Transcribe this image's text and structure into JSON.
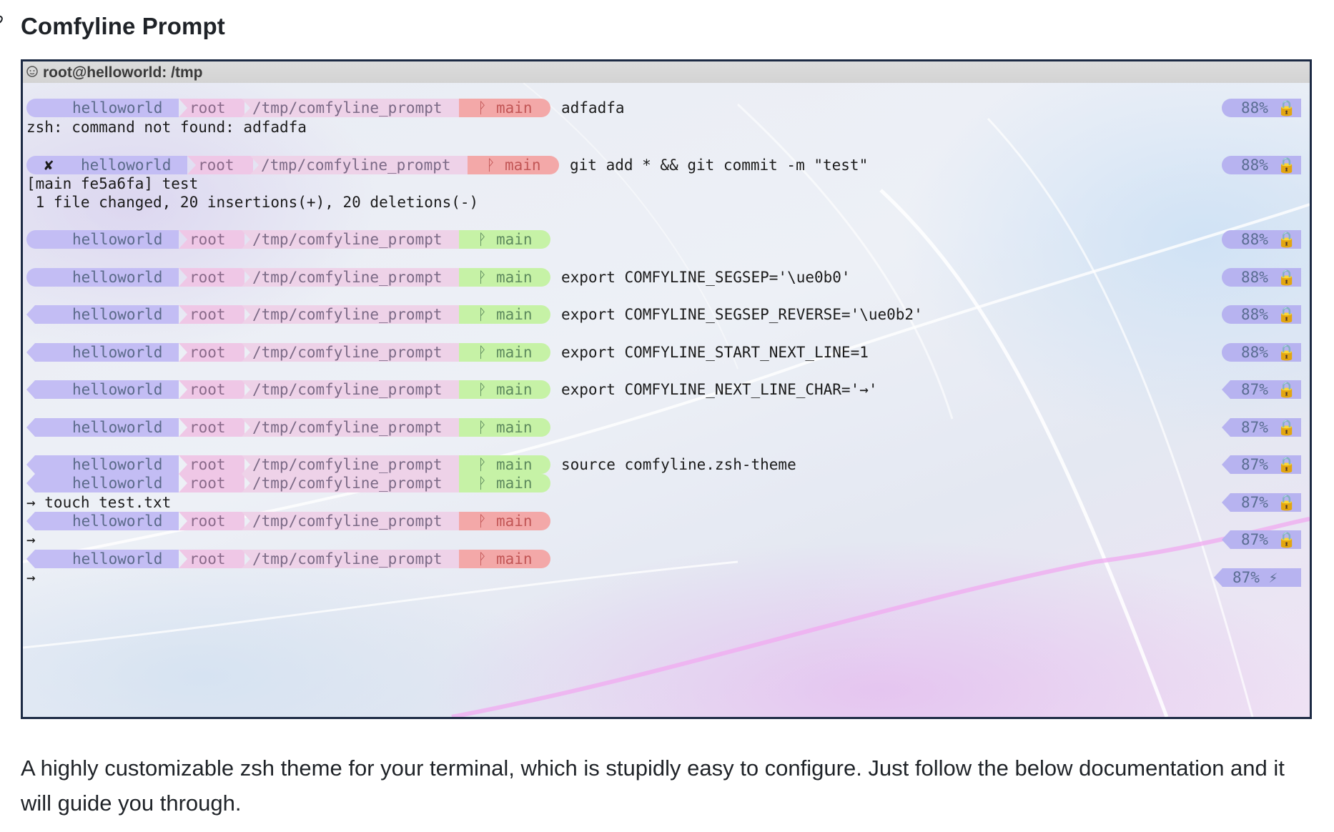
{
  "heading": {
    "title": "Comfyline Prompt"
  },
  "terminal": {
    "window_title": "root@helloworld: /tmp",
    "segments": {
      "host": "helloworld",
      "user": "root",
      "dir": "/tmp/comfyline_prompt",
      "branch": "main"
    },
    "status_x": "✘",
    "battery_lock": "88% 🔒",
    "battery_87": "87% 🔒",
    "battery_charging": "87% ⚡",
    "commands": {
      "c1": "adfadfa",
      "c2": "git add * && git commit -m \"test\"",
      "c4": "export COMFYLINE_SEGSEP='\\ue0b0'",
      "c5": "export COMFYLINE_SEGSEP_REVERSE='\\ue0b2'",
      "c6": "export COMFYLINE_START_NEXT_LINE=1",
      "c7": "export COMFYLINE_NEXT_LINE_CHAR='→'",
      "c9": "source comfyline.zsh-theme"
    },
    "outputs": {
      "o1": "zsh: command not found: adfadfa",
      "o2a": "[main fe5a6fa] test",
      "o2b": " 1 file changed, 20 insertions(+), 20 deletions(-)",
      "o10": "→ touch test.txt",
      "arrow": "→"
    }
  },
  "description": "A highly customizable zsh theme for your terminal, which is stupidly easy to configure. Just follow the below documentation and it will guide you through."
}
